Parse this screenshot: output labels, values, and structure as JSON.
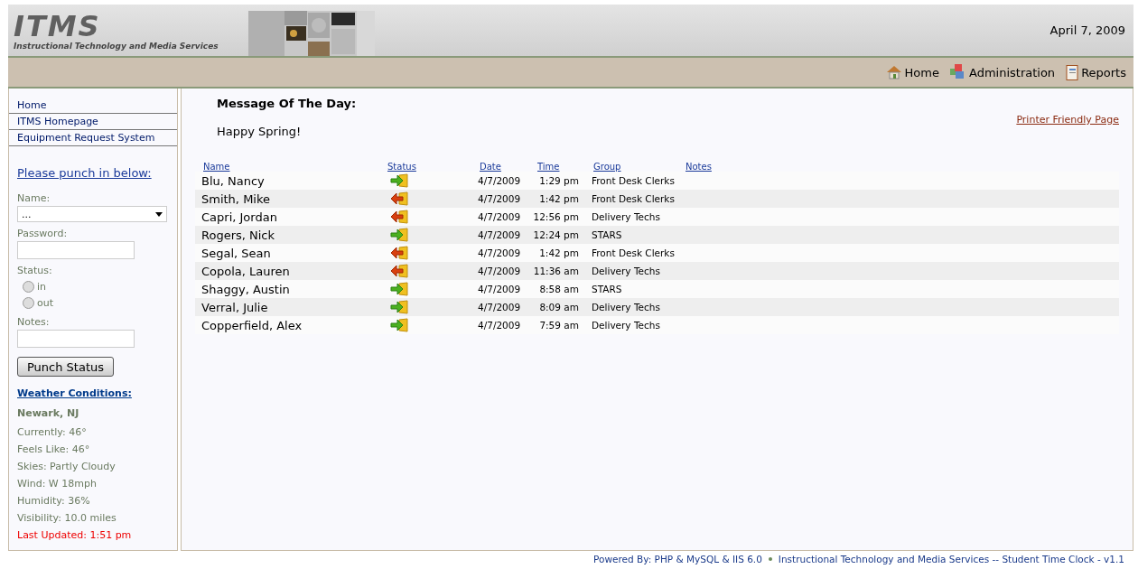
{
  "header": {
    "logo_title": "ITMS",
    "logo_subtitle": "Instructional Technology and Media Services",
    "date": "April 7, 2009"
  },
  "nav": [
    {
      "label": "Home",
      "kind": "house"
    },
    {
      "label": "Administration",
      "kind": "blocks"
    },
    {
      "label": "Reports",
      "kind": "notebook"
    }
  ],
  "sidebar": {
    "links": [
      "Home",
      "ITMS Homepage",
      "Equipment Request System"
    ],
    "punch_form": {
      "heading": "Please punch in below:",
      "name_label": "Name:",
      "name_value": "...",
      "password_label": "Password:",
      "status_label": "Status:",
      "status_options": [
        {
          "label": "in",
          "selected": false
        },
        {
          "label": "out",
          "selected": false
        }
      ],
      "notes_label": "Notes:",
      "submit": "Punch Status"
    },
    "weather": {
      "heading": "Weather Conditions:",
      "location": "Newark, NJ",
      "lines": [
        "Currently: 46°",
        "Feels Like: 46°",
        "Skies: Partly Cloudy",
        "Wind: W 18mph",
        "Humidity: 36%",
        "Visibility: 10.0 miles"
      ],
      "last_updated": "Last Updated: 1:51 pm"
    }
  },
  "main": {
    "motd_title": "Message Of The Day:",
    "motd_text": "Happy Spring!",
    "printer_link": "Printer Friendly Page",
    "table": {
      "columns": [
        "Name",
        "Status",
        "Date",
        "Time",
        "Group",
        "Notes"
      ],
      "rows": [
        {
          "name": "Blu, Nancy",
          "kind": "in",
          "date": "4/7/2009",
          "time": "1:29 pm",
          "group": "Front Desk Clerks"
        },
        {
          "name": "Smith, Mike",
          "kind": "out",
          "date": "4/7/2009",
          "time": "1:42 pm",
          "group": "Front Desk Clerks"
        },
        {
          "name": "Capri, Jordan",
          "kind": "out",
          "date": "4/7/2009",
          "time": "12:56 pm",
          "group": "Delivery Techs"
        },
        {
          "name": "Rogers, Nick",
          "kind": "in",
          "date": "4/7/2009",
          "time": "12:24 pm",
          "group": "STARS"
        },
        {
          "name": "Segal, Sean",
          "kind": "out",
          "date": "4/7/2009",
          "time": "1:42 pm",
          "group": "Front Desk Clerks"
        },
        {
          "name": "Copola, Lauren",
          "kind": "out",
          "date": "4/7/2009",
          "time": "11:36 am",
          "group": "Delivery Techs"
        },
        {
          "name": "Shaggy, Austin",
          "kind": "in",
          "date": "4/7/2009",
          "time": "8:58 am",
          "group": "STARS"
        },
        {
          "name": "Verral, Julie",
          "kind": "in",
          "date": "4/7/2009",
          "time": "8:09 am",
          "group": "Delivery Techs"
        },
        {
          "name": "Copperfield, Alex",
          "kind": "in",
          "date": "4/7/2009",
          "time": "7:59 am",
          "group": "Delivery Techs"
        }
      ]
    }
  },
  "footer": {
    "powered": "Powered By: PHP & MySQL & IIS 6.0",
    "credit": "Instructional Technology and Media Services -- Student Time Clock - v1.1"
  }
}
